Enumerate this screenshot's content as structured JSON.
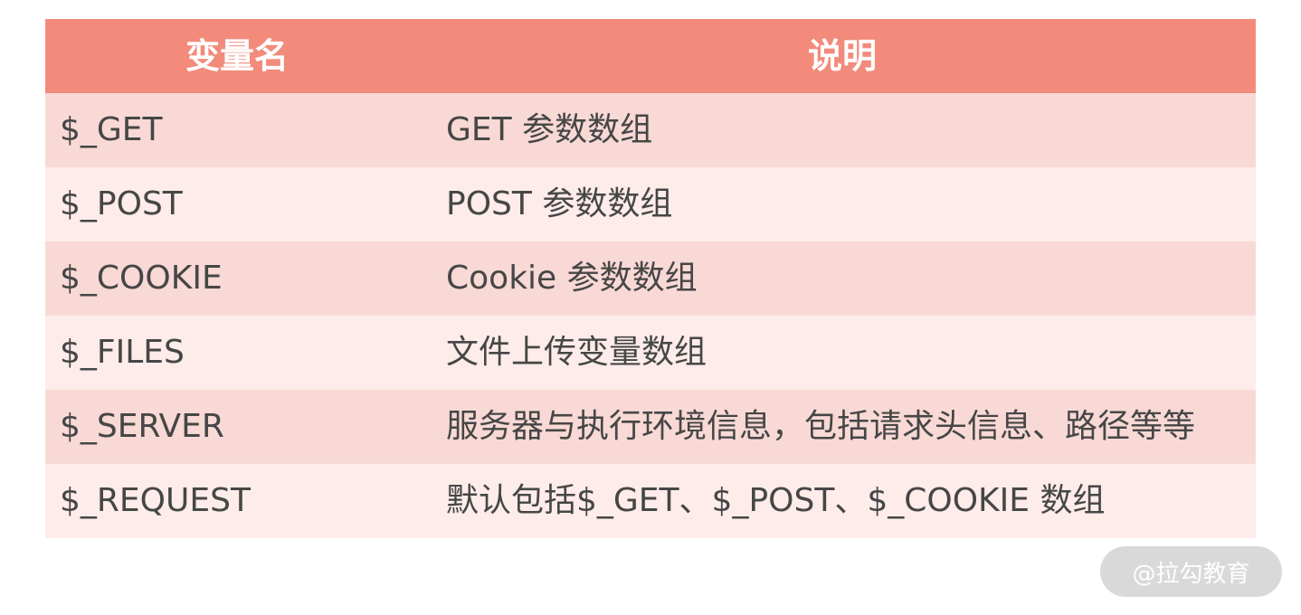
{
  "table": {
    "headers": {
      "name": "变量名",
      "desc": "说明"
    },
    "rows": [
      {
        "name": "$_GET",
        "desc": "GET 参数数组"
      },
      {
        "name": "$_POST",
        "desc": "POST 参数数组"
      },
      {
        "name": "$_COOKIE",
        "desc": "Cookie 参数数组"
      },
      {
        "name": "$_FILES",
        "desc": "文件上传变量数组"
      },
      {
        "name": "$_SERVER",
        "desc": "服务器与执行环境信息，包括请求头信息、路径等等"
      },
      {
        "name": "$_REQUEST",
        "desc": "默认包括$_GET、$_POST、$_COOKIE 数组"
      }
    ]
  },
  "watermark": {
    "text": "@拉勾教育"
  },
  "colors": {
    "header_bg": "#f28b7b",
    "row_odd_bg": "#f8d9d6",
    "row_even_bg": "#fdecea",
    "text": "#464646",
    "watermark_bg": "#d9d9d9"
  }
}
